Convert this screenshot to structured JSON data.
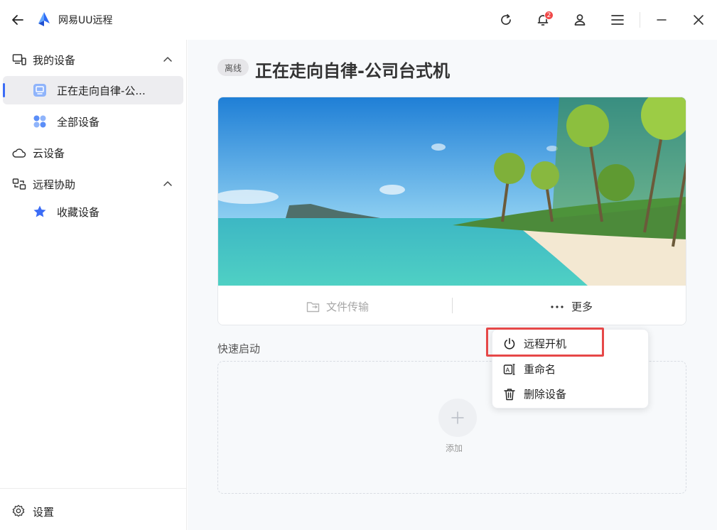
{
  "app": {
    "title": "网易UU远程"
  },
  "titlebar": {
    "notification_count": "2"
  },
  "sidebar": {
    "my_devices": "我的设备",
    "device_item": "正在走向自律-公...",
    "all_devices": "全部设备",
    "cloud_devices": "云设备",
    "remote_assist": "远程协助",
    "favorites": "收藏设备",
    "settings": "设置"
  },
  "main": {
    "status_badge": "离线",
    "device_title": "正在走向自律-公司台式机",
    "file_transfer": "文件传输",
    "more": "更多",
    "quick_launch": "快速启动",
    "add": "添加"
  },
  "dropdown": {
    "items": [
      {
        "label": "远程开机",
        "icon": "power-icon"
      },
      {
        "label": "重命名",
        "icon": "rename-icon"
      },
      {
        "label": "删除设备",
        "icon": "trash-icon"
      }
    ]
  },
  "colors": {
    "accent": "#3b6cf6",
    "badge": "#f04848",
    "highlight": "#e64848"
  }
}
